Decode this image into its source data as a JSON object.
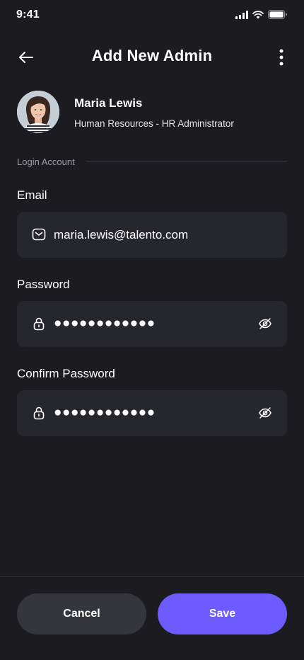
{
  "status_bar": {
    "time": "9:41"
  },
  "nav": {
    "title": "Add New Admin"
  },
  "profile": {
    "name": "Maria Lewis",
    "role": "Human Resources - HR Administrator"
  },
  "section": {
    "label": "Login Account"
  },
  "form": {
    "email": {
      "label": "Email",
      "value": "maria.lewis@talento.com",
      "icon": "mail-icon"
    },
    "password": {
      "label": "Password",
      "value": "●●●●●●●●●●●●",
      "icon": "lock-icon"
    },
    "confirm_password": {
      "label": "Confirm Password",
      "value": "●●●●●●●●●●●●",
      "icon": "lock-icon"
    }
  },
  "actions": {
    "cancel_label": "Cancel",
    "save_label": "Save"
  },
  "colors": {
    "background": "#1b1b20",
    "field": "#26262d",
    "accent": "#6c5cff",
    "secondary_button": "#35363c"
  }
}
